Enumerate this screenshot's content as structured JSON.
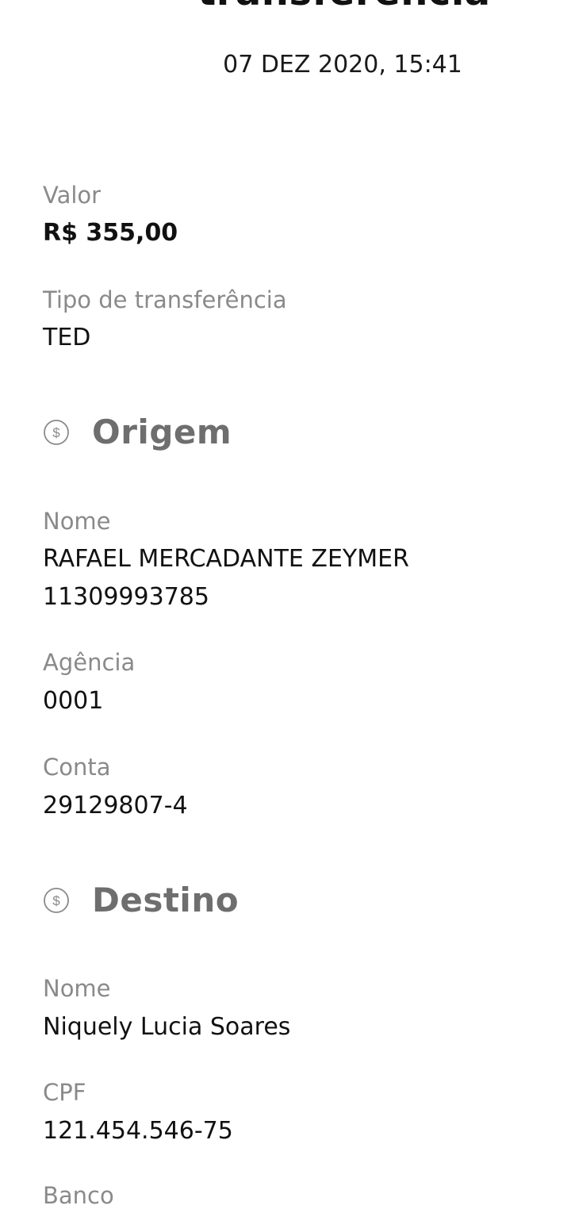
{
  "header": {
    "title": "transferência",
    "datetime": "07 DEZ 2020, 15:41"
  },
  "transfer": {
    "amount_label": "Valor",
    "amount_value": "R$ 355,00",
    "type_label": "Tipo de transferência",
    "type_value": "TED"
  },
  "origin": {
    "section_title": "Origem",
    "section_icon": "dollar-coin-icon",
    "name_label": "Nome",
    "name_value": "RAFAEL MERCADANTE ZEYMER",
    "document_value": "11309993785",
    "agency_label": "Agência",
    "agency_value": "0001",
    "account_label": "Conta",
    "account_value": "29129807-4"
  },
  "destination": {
    "section_title": "Destino",
    "section_icon": "dollar-coin-icon",
    "name_label": "Nome",
    "name_value": "Niquely Lucia Soares",
    "cpf_label": "CPF",
    "cpf_value": "121.454.546-75",
    "bank_label": "Banco"
  }
}
